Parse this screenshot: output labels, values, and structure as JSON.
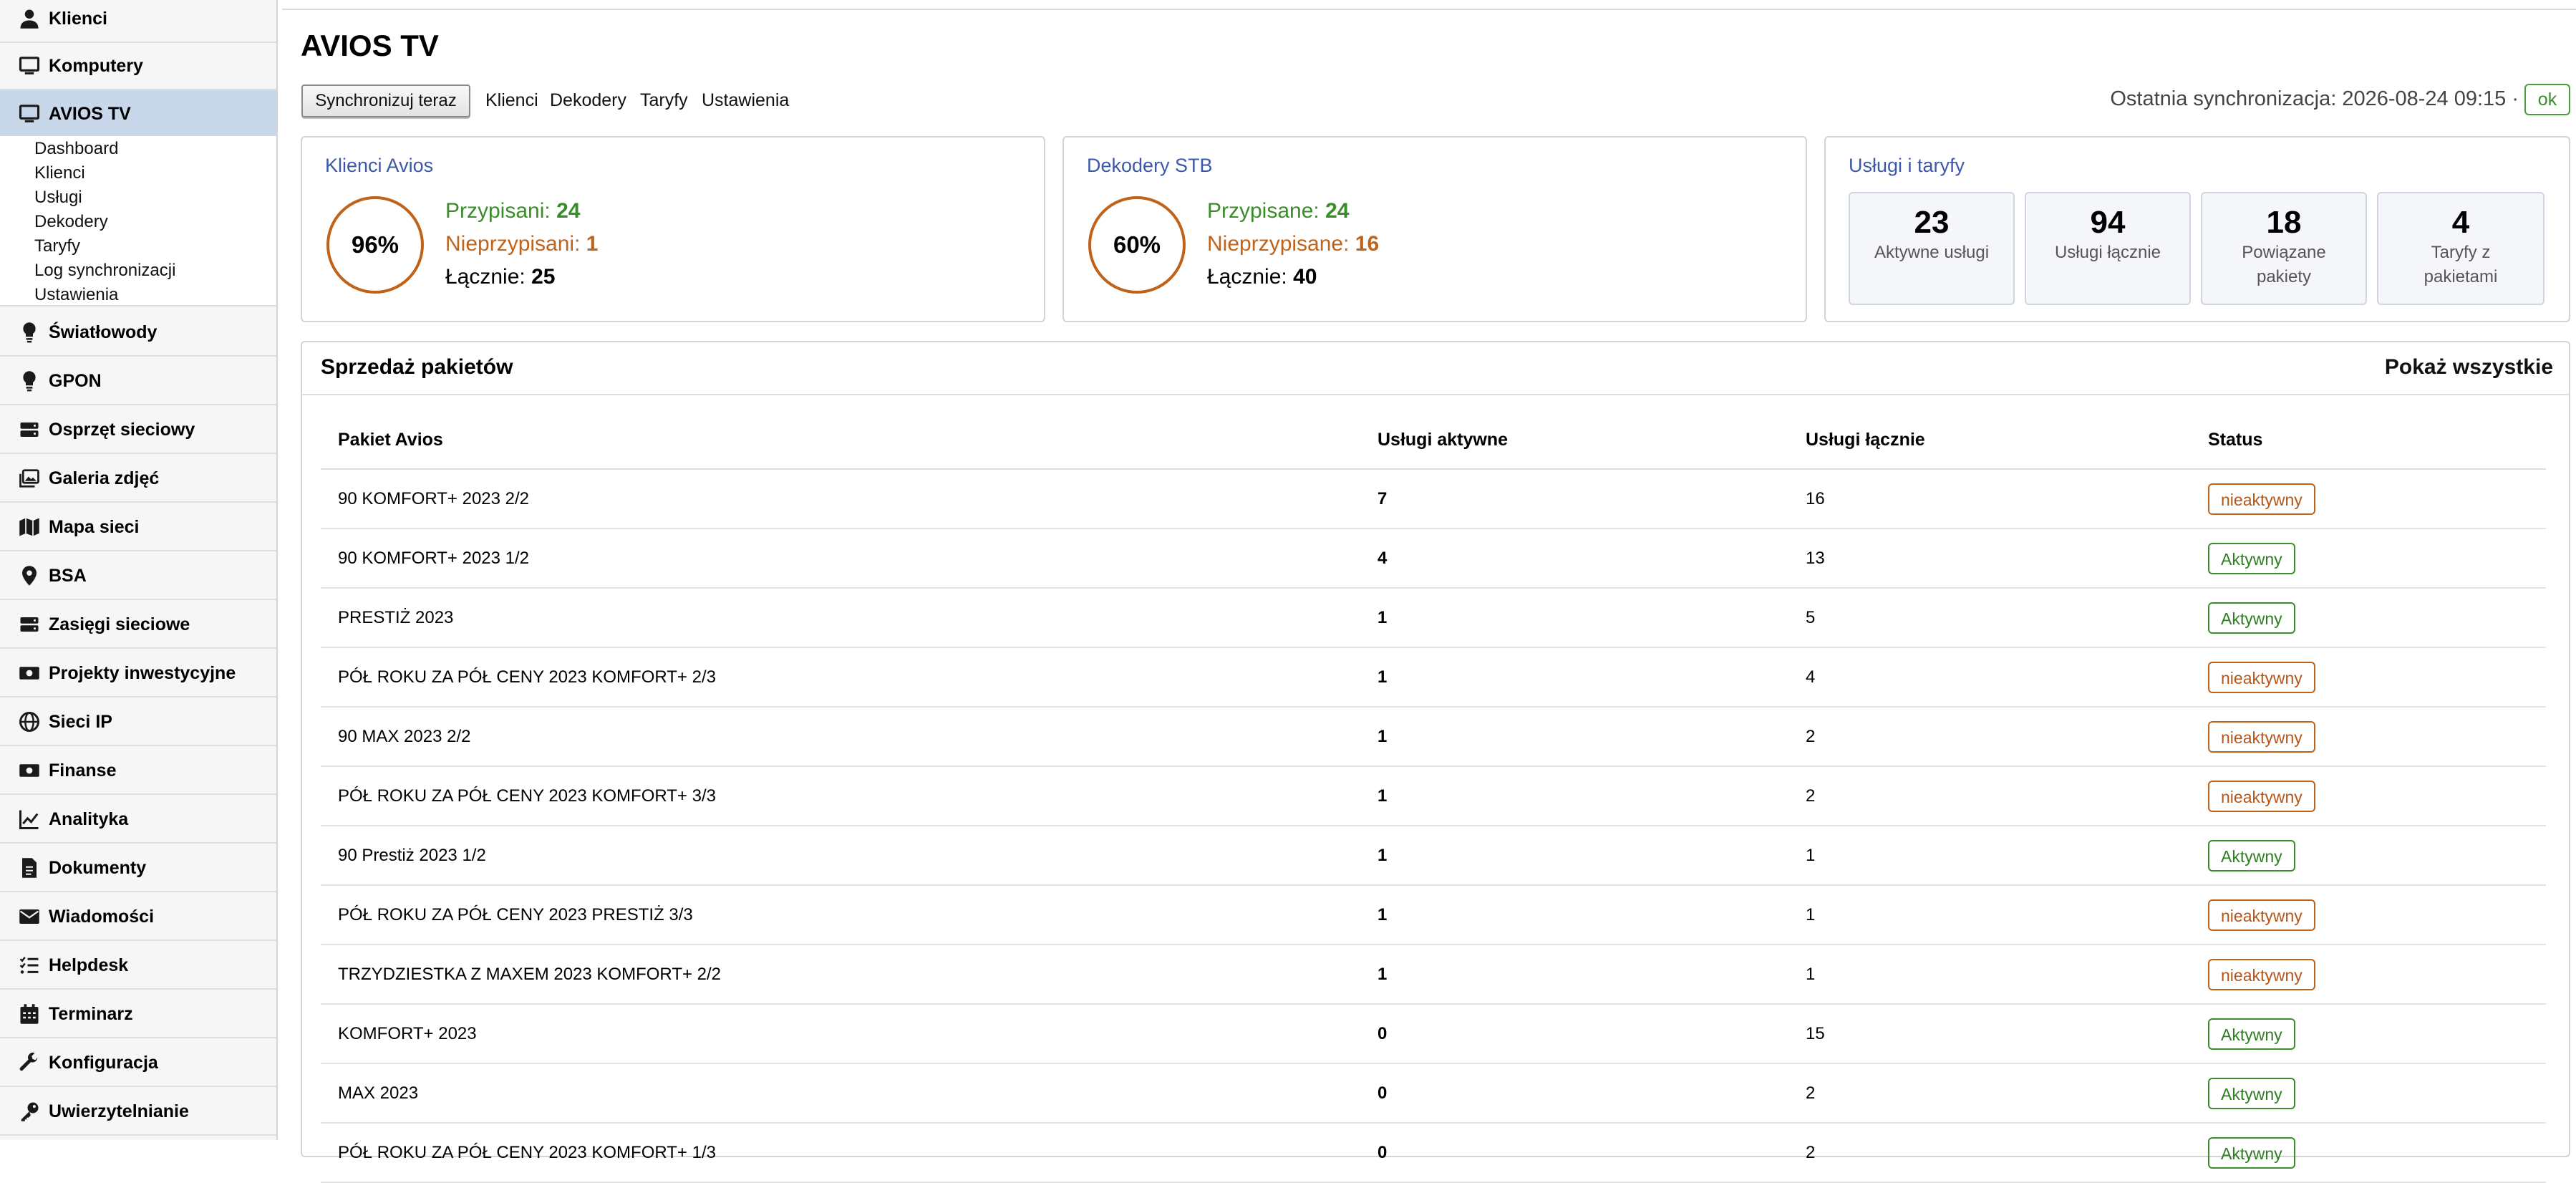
{
  "sidebar": {
    "items": [
      {
        "label": "Klienci",
        "icon": "user-icon"
      },
      {
        "label": "Komputery",
        "icon": "monitor-icon"
      },
      {
        "label": "AVIOS TV",
        "icon": "tv-icon"
      },
      {
        "label": "Światłowody",
        "icon": "lightbulb-icon"
      },
      {
        "label": "GPON",
        "icon": "lightbulb-icon"
      },
      {
        "label": "Osprzęt sieciowy",
        "icon": "server-icon"
      },
      {
        "label": "Galeria zdjęć",
        "icon": "images-icon"
      },
      {
        "label": "Mapa sieci",
        "icon": "map-icon"
      },
      {
        "label": "BSA",
        "icon": "map-pin-icon"
      },
      {
        "label": "Zasięgi sieciowe",
        "icon": "server-icon"
      },
      {
        "label": "Projekty inwestycyjne",
        "icon": "money-icon"
      },
      {
        "label": "Sieci IP",
        "icon": "globe-icon"
      },
      {
        "label": "Finanse",
        "icon": "money-icon"
      },
      {
        "label": "Analityka",
        "icon": "chart-line-icon"
      },
      {
        "label": "Dokumenty",
        "icon": "document-icon"
      },
      {
        "label": "Wiadomości",
        "icon": "envelope-icon"
      },
      {
        "label": "Helpdesk",
        "icon": "list-check-icon"
      },
      {
        "label": "Terminarz",
        "icon": "calendar-icon"
      },
      {
        "label": "Konfiguracja",
        "icon": "wrench-icon"
      },
      {
        "label": "Uwierzytelnianie",
        "icon": "key-icon"
      }
    ],
    "submenu": [
      "Dashboard",
      "Klienci",
      "Usługi",
      "Dekodery",
      "Taryfy",
      "Log synchronizacji",
      "Ustawienia"
    ]
  },
  "header": {
    "title": "AVIOS TV",
    "sync_button": "Synchronizuj teraz",
    "links": [
      "Klienci",
      "Dekodery",
      "Taryfy",
      "Ustawienia"
    ],
    "last_sync": "Ostatnia synchronizacja: 2026-08-24 09:15 ·",
    "status": "ok"
  },
  "cards": {
    "clients": {
      "title": "Klienci Avios",
      "percent": "96%",
      "percent_value": 0.96,
      "assigned_label": "Przypisani:",
      "assigned_value": "24",
      "unassigned_label": "Nieprzypisani:",
      "unassigned_value": "1",
      "total_label": "Łącznie:",
      "total_value": "25"
    },
    "decoders": {
      "title": "Dekodery STB",
      "percent": "60%",
      "percent_value": 0.6,
      "assigned_label": "Przypisane:",
      "assigned_value": "24",
      "unassigned_label": "Nieprzypisane:",
      "unassigned_value": "16",
      "total_label": "Łącznie:",
      "total_value": "40"
    },
    "services": {
      "title": "Usługi i taryfy",
      "tiles": [
        {
          "value": "23",
          "label": "Aktywne usługi"
        },
        {
          "value": "94",
          "label": "Usługi łącznie"
        },
        {
          "value": "18",
          "label": "Powiązane pakiety"
        },
        {
          "value": "4",
          "label": "Taryfy z pakietami"
        }
      ]
    }
  },
  "sales": {
    "title": "Sprzedaż pakietów",
    "show_all": "Pokaż wszystkie",
    "columns": [
      "Pakiet Avios",
      "Usługi aktywne",
      "Usługi łącznie",
      "Status"
    ],
    "rows": [
      {
        "name": "90 KOMFORT+ 2023 2/2",
        "active": "7",
        "total": "16",
        "status": "nieaktywny"
      },
      {
        "name": "90 KOMFORT+ 2023 1/2",
        "active": "4",
        "total": "13",
        "status": "Aktywny"
      },
      {
        "name": "PRESTIŻ 2023",
        "active": "1",
        "total": "5",
        "status": "Aktywny"
      },
      {
        "name": "PÓŁ ROKU ZA PÓŁ CENY 2023 KOMFORT+ 2/3",
        "active": "1",
        "total": "4",
        "status": "nieaktywny"
      },
      {
        "name": "90 MAX 2023 2/2",
        "active": "1",
        "total": "2",
        "status": "nieaktywny"
      },
      {
        "name": "PÓŁ ROKU ZA PÓŁ CENY 2023 KOMFORT+ 3/3",
        "active": "1",
        "total": "2",
        "status": "nieaktywny"
      },
      {
        "name": "90 Prestiż 2023 1/2",
        "active": "1",
        "total": "1",
        "status": "Aktywny"
      },
      {
        "name": "PÓŁ ROKU ZA PÓŁ CENY 2023 PRESTIŻ 3/3",
        "active": "1",
        "total": "1",
        "status": "nieaktywny"
      },
      {
        "name": "TRZYDZIESTKA Z MAXEM 2023 KOMFORT+ 2/2",
        "active": "1",
        "total": "1",
        "status": "nieaktywny"
      },
      {
        "name": "KOMFORT+ 2023",
        "active": "0",
        "total": "15",
        "status": "Aktywny"
      },
      {
        "name": "MAX 2023",
        "active": "0",
        "total": "2",
        "status": "Aktywny"
      },
      {
        "name": "PÓŁ ROKU ZA PÓŁ CENY 2023 KOMFORT+ 1/3",
        "active": "0",
        "total": "2",
        "status": "Aktywny"
      }
    ]
  },
  "colors": {
    "accent_blue": "#3c59a8",
    "green": "#3a8d2a",
    "orange": "#c0631a",
    "active_nav": "#c8d7ea"
  }
}
